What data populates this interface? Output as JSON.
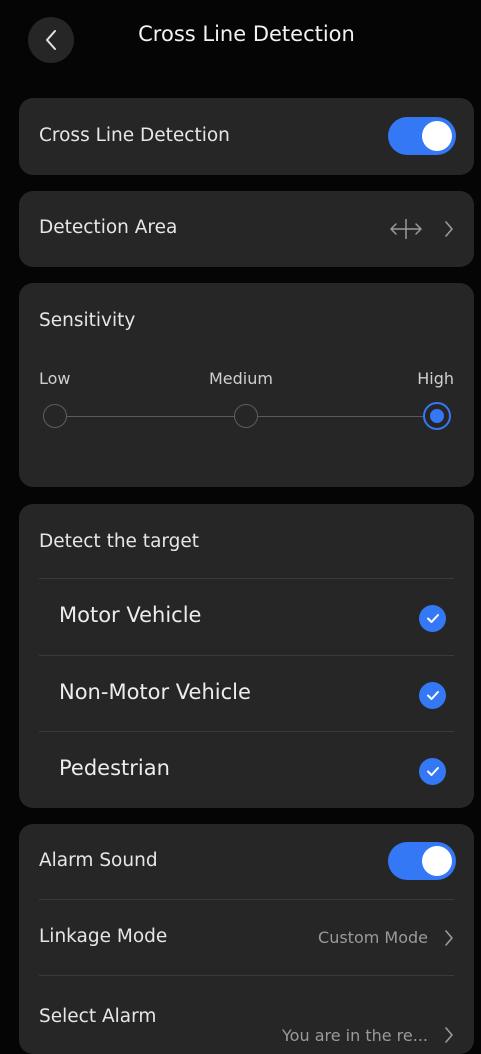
{
  "header": {
    "title": "Cross Line Detection"
  },
  "cross_line": {
    "label": "Cross Line Detection",
    "enabled": true
  },
  "detection_area": {
    "label": "Detection Area"
  },
  "sensitivity": {
    "title": "Sensitivity",
    "levels": [
      "Low",
      "Medium",
      "High"
    ],
    "selected": "High"
  },
  "targets": {
    "title": "Detect the target",
    "items": [
      {
        "label": "Motor Vehicle",
        "checked": true
      },
      {
        "label": "Non-Motor Vehicle",
        "checked": true
      },
      {
        "label": "Pedestrian",
        "checked": true
      }
    ]
  },
  "alarm": {
    "sound_label": "Alarm Sound",
    "sound_enabled": true,
    "linkage_label": "Linkage Mode",
    "linkage_value": "Custom Mode",
    "select_label": "Select Alarm",
    "select_value": "You are in the re..."
  },
  "colors": {
    "accent": "#3478f6",
    "background": "#050505",
    "card": "#262626"
  }
}
